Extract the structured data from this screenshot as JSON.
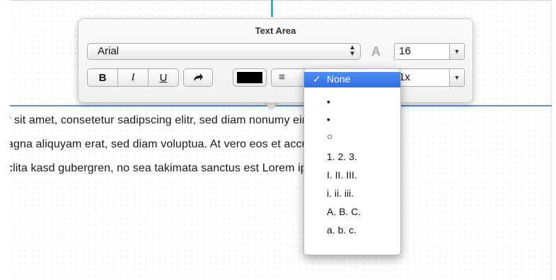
{
  "popover": {
    "title": "Text Area",
    "font_name": "Arial",
    "font_size": "16",
    "bold_label": "B",
    "italic_label": "I",
    "underline_label": "U",
    "redo_icon": "redo-arrow-icon",
    "text_color": "#000000",
    "align_icon": "align-left-icon",
    "line_spacing_partial": "1x"
  },
  "list_menu": {
    "check_mark": "✓",
    "items": [
      {
        "label": "None",
        "selected": true
      },
      {
        "label": "•"
      },
      {
        "label": "▪"
      },
      {
        "label": "○"
      },
      {
        "label": "1. 2. 3."
      },
      {
        "label": "I. II. III."
      },
      {
        "label": "i. ii. iii."
      },
      {
        "label": "A. B. C."
      },
      {
        "label": "a. b. c."
      }
    ]
  },
  "text_area": {
    "lines": [
      "r sit amet, consetetur sadipscing elitr, sed diam nonumy eirmod tempo",
      "agna aliquyam erat, sed diam voluptua. At vero eos et accusam et jus",
      "clita kasd gubergren, no sea takimata sanctus est Lorem ipsum dolor s"
    ]
  },
  "colors": {
    "guide_cyan": "#1fb5c4",
    "guide_blue": "#5a8fd6",
    "menu_highlight": "#3a7ef0"
  }
}
